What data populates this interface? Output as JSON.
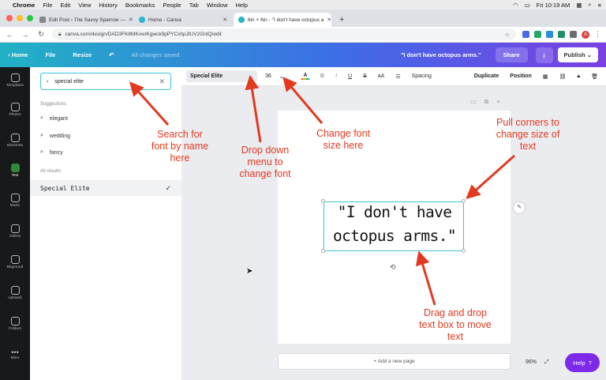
{
  "mac_menubar": {
    "app": "Chrome",
    "menus": [
      "File",
      "Edit",
      "View",
      "History",
      "Bookmarks",
      "People",
      "Tab",
      "Window",
      "Help"
    ],
    "clock": "Fri 10:19 AM"
  },
  "browser": {
    "tabs": [
      {
        "label": "Edit Post ‹ The Savvy Sparrow —",
        "active": false
      },
      {
        "label": "Home - Canva",
        "active": false
      },
      {
        "label": "6in × 6in - \"I don't have octopus a",
        "active": true
      }
    ],
    "new_tab_glyph": "+",
    "url": "canva.com/design/DAD3FK8MKvw/Kgwck9pPYCxhpJtUV2GnlQ/edit"
  },
  "canva_header": {
    "home": "Home",
    "file": "File",
    "resize": "Resize",
    "saved_status": "All changes saved",
    "design_title": "\"I don't have octopus arms.\"",
    "share": "Share",
    "publish": "Publish"
  },
  "rail": [
    {
      "label": "Templates",
      "active": false
    },
    {
      "label": "Photos",
      "active": false
    },
    {
      "label": "Elements",
      "active": false
    },
    {
      "label": "Text",
      "active": true
    },
    {
      "label": "Music",
      "active": false
    },
    {
      "label": "Videos",
      "active": false
    },
    {
      "label": "Bkground",
      "active": false
    },
    {
      "label": "Uploads",
      "active": false
    },
    {
      "label": "Folders",
      "active": false
    },
    {
      "label": "More",
      "active": false
    }
  ],
  "font_panel": {
    "search_value": "special elite",
    "suggestions_label": "Suggestions",
    "suggestions": [
      "elegant",
      "wedding",
      "fancy"
    ],
    "results_label": "All results",
    "result": "Special Elite"
  },
  "toolbar": {
    "font": "Special Elite",
    "size": "36",
    "bold": "B",
    "italic": "I",
    "case": "aA",
    "spacing": "Spacing",
    "duplicate": "Duplicate",
    "position": "Position"
  },
  "canvas": {
    "quote_line1": "\"I don't have",
    "quote_line2": "octopus arms.\"",
    "add_page": "+ Add a new page",
    "zoom": "96%",
    "help": "Help",
    "help_glyph": "?"
  },
  "annotations": {
    "search": [
      "Search for",
      "font by name",
      "here"
    ],
    "dropdown": [
      "Drop down",
      "menu to",
      "change font"
    ],
    "size": [
      "Change font",
      "size here"
    ],
    "corners": [
      "Pull corners to",
      "change size of",
      "text"
    ],
    "drag": [
      "Drag and drop",
      "text box to move",
      "text"
    ],
    "color": "#e23a1f"
  }
}
